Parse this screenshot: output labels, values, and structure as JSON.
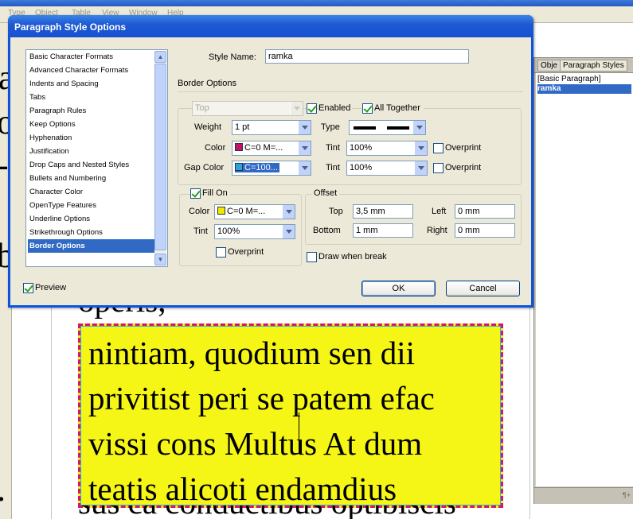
{
  "app": {
    "menu": [
      "Type",
      "Object",
      "Table",
      "View",
      "Window",
      "Help"
    ]
  },
  "document": {
    "bg_glyphs": [
      "a",
      "o",
      "-",
      "b",
      "."
    ],
    "above_frame_text": "operis,",
    "frame_lines": [
      "nintiam, quodium sen dii",
      "privitist peri se patem efac",
      "vissi cons Multus At dum",
      "teatis alicoti endamdius"
    ],
    "below_frame_text": "sus ca conductibus optibiscis",
    "colors": {
      "frame_fill": "#f5f516",
      "frame_border": "#d6166e",
      "frame_gap": "#33b0e0"
    }
  },
  "panel": {
    "tabs": [
      "Obje",
      "Paragraph Styles"
    ],
    "items": [
      "[Basic Paragraph]",
      "ramka"
    ],
    "selected": "ramka",
    "footer": "¶+"
  },
  "dialog": {
    "title": "Paragraph Style Options",
    "categories": [
      "Basic Character Formats",
      "Advanced Character Formats",
      "Indents and Spacing",
      "Tabs",
      "Paragraph Rules",
      "Keep Options",
      "Hyphenation",
      "Justification",
      "Drop Caps and Nested Styles",
      "Bullets and Numbering",
      "Character Color",
      "OpenType Features",
      "Underline Options",
      "Strikethrough Options",
      "Border Options"
    ],
    "selected_category": "Border Options",
    "style_name_label": "Style Name:",
    "style_name": "ramka",
    "section_title": "Border Options",
    "border": {
      "side": "Top",
      "enabled_label": "Enabled",
      "enabled": true,
      "all_together_label": "All Together",
      "all_together": true,
      "weight_label": "Weight",
      "weight": "1 pt",
      "type_label": "Type",
      "color_label": "Color",
      "color": "C=0 M=...",
      "color_swatch": "#c0146a",
      "tint_label": "Tint",
      "tint": "100%",
      "overprint_label": "Overprint",
      "overprint": false,
      "gap_color_label": "Gap Color",
      "gap_color": "C=100...",
      "gap_color_swatch": "#2aa3e0",
      "gap_tint_label": "Tint",
      "gap_tint": "100%",
      "gap_overprint_label": "Overprint",
      "gap_overprint": false
    },
    "fill": {
      "fill_on_label": "Fill On",
      "fill_on": true,
      "color_label": "Color",
      "color": "C=0 M=...",
      "color_swatch": "#f0ea00",
      "tint_label": "Tint",
      "tint": "100%",
      "overprint_label": "Overprint",
      "overprint": false
    },
    "offset": {
      "title": "Offset",
      "top_label": "Top",
      "top": "3,5 mm",
      "left_label": "Left",
      "left": "0 mm",
      "bottom_label": "Bottom",
      "bottom": "1 mm",
      "right_label": "Right",
      "right": "0 mm"
    },
    "draw_when_break_label": "Draw when break",
    "draw_when_break": false,
    "preview_label": "Preview",
    "preview": true,
    "ok_label": "OK",
    "cancel_label": "Cancel"
  }
}
